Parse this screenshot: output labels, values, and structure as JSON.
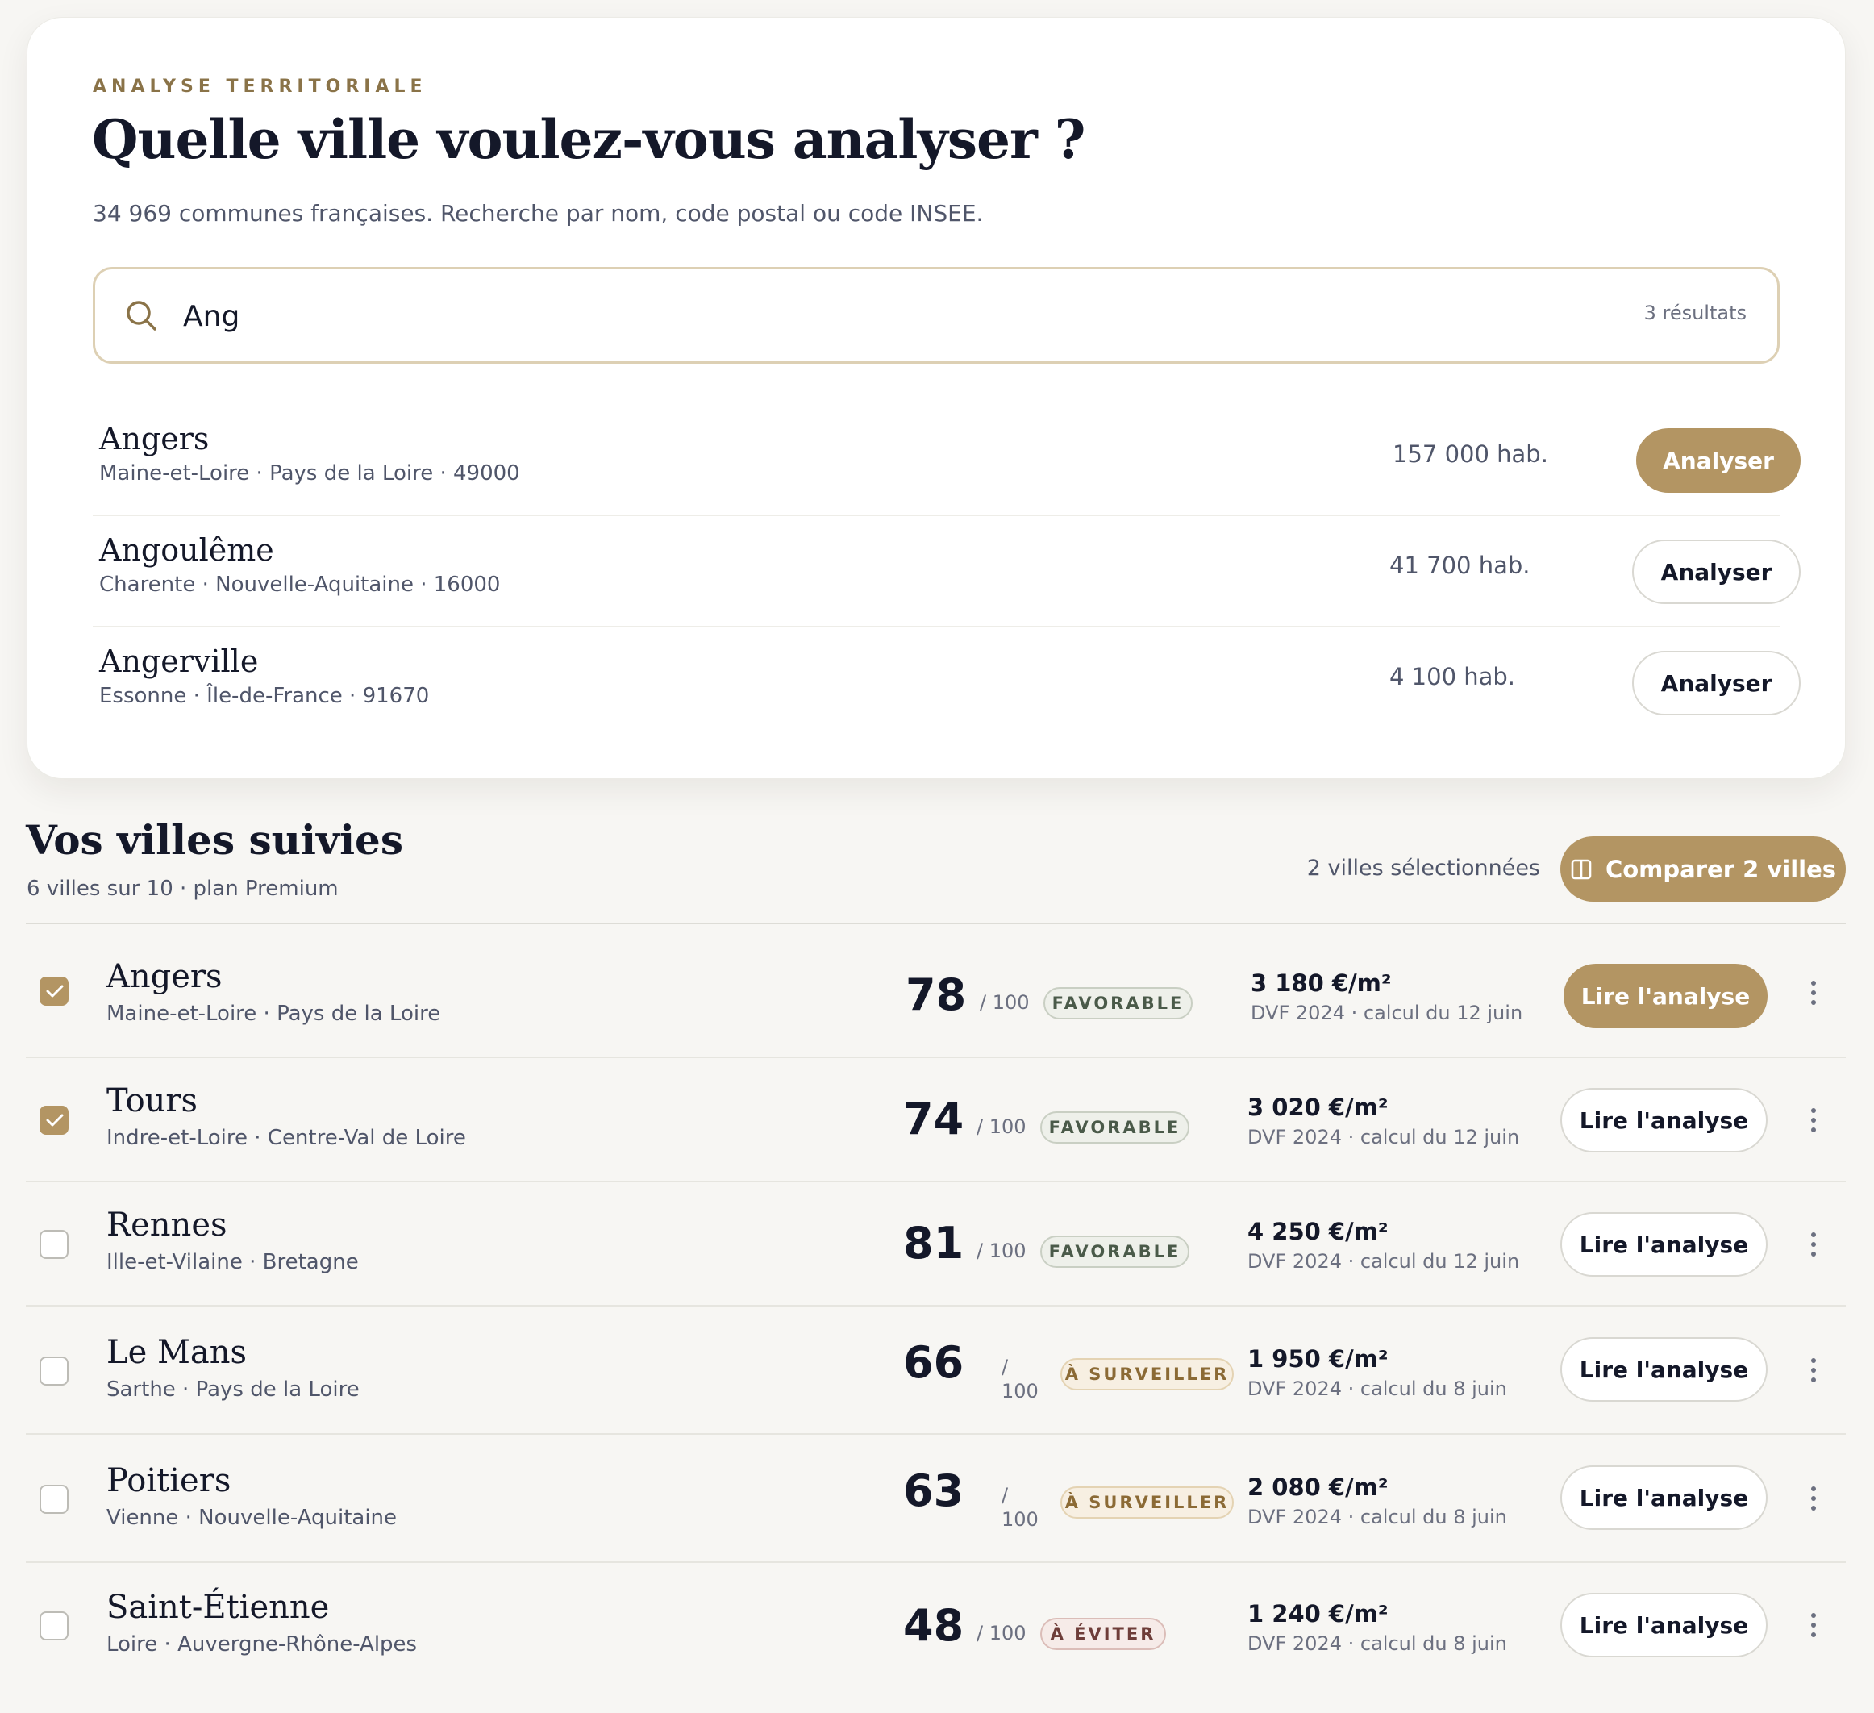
{
  "search": {
    "eyebrow": "ANALYSE TERRITORIALE",
    "title": "Quelle ville voulez-vous analyser ?",
    "subtitle": "34 969 communes françaises. Recherche par nom, code postal ou code INSEE.",
    "query": "Ang",
    "result_count": "3 résultats",
    "results": [
      {
        "name": "Angers",
        "meta": "Maine-et-Loire · Pays de la Loire · 49000",
        "population": "157 000 hab.",
        "action": "Analyser",
        "highlighted": true
      },
      {
        "name": "Angoulême",
        "meta": "Charente · Nouvelle-Aquitaine · 16000",
        "population": "41 700 hab.",
        "action": "Analyser",
        "highlighted": false
      },
      {
        "name": "Angerville",
        "meta": "Essonne · Île-de-France · 91670",
        "population": "4 100 hab.",
        "action": "Analyser",
        "highlighted": false
      }
    ]
  },
  "followed": {
    "title": "Vos villes suivies",
    "subtitle": "6 villes sur 10 · plan Premium",
    "selected_count": "2 villes sélectionnées",
    "compare_label": "Comparer 2 villes",
    "rows": [
      {
        "name": "Angers",
        "meta": "Maine-et-Loire · Pays de la Loire",
        "score": "78",
        "score_max": "/ 100",
        "badge": "FAVORABLE",
        "price": "3 180 €/m²",
        "price_meta": "DVF 2024 · calcul du 12 juin",
        "action": "Lire l'analyse",
        "checked": true,
        "primary": true
      },
      {
        "name": "Tours",
        "meta": "Indre-et-Loire · Centre-Val de Loire",
        "score": "74",
        "score_max": "/ 100",
        "badge": "FAVORABLE",
        "price": "3 020 €/m²",
        "price_meta": "DVF 2024 · calcul du 12 juin",
        "action": "Lire l'analyse",
        "checked": true,
        "primary": false
      },
      {
        "name": "Rennes",
        "meta": "Ille-et-Vilaine · Bretagne",
        "score": "81",
        "score_max": "/ 100",
        "badge": "FAVORABLE",
        "price": "4 250 €/m²",
        "price_meta": "DVF 2024 · calcul du 12 juin",
        "action": "Lire l'analyse",
        "checked": false,
        "primary": false
      },
      {
        "name": "Le Mans",
        "meta": "Sarthe · Pays de la Loire",
        "score": "66",
        "score_max_a": "/",
        "score_max_b": "100",
        "badge": "À SURVEILLER",
        "price": "1 950 €/m²",
        "price_meta": "DVF 2024 · calcul du 8 juin",
        "action": "Lire l'analyse",
        "checked": false,
        "primary": false
      },
      {
        "name": "Poitiers",
        "meta": "Vienne · Nouvelle-Aquitaine",
        "score": "63",
        "score_max_a": "/",
        "score_max_b": "100",
        "badge": "À SURVEILLER",
        "price": "2 080 €/m²",
        "price_meta": "DVF 2024 · calcul du 8 juin",
        "action": "Lire l'analyse",
        "checked": false,
        "primary": false
      },
      {
        "name": "Saint-Étienne",
        "meta": "Loire · Auvergne-Rhône-Alpes",
        "score": "48",
        "score_max": "/ 100",
        "badge": "À ÉVITER",
        "price": "1 240 €/m²",
        "price_meta": "DVF 2024 · calcul du 8 juin",
        "action": "Lire l'analyse",
        "checked": false,
        "primary": false
      }
    ]
  },
  "colors": {
    "accent": "#b39563",
    "text": "#141829",
    "muted": "#50566a",
    "background": "#f7f6f3"
  }
}
